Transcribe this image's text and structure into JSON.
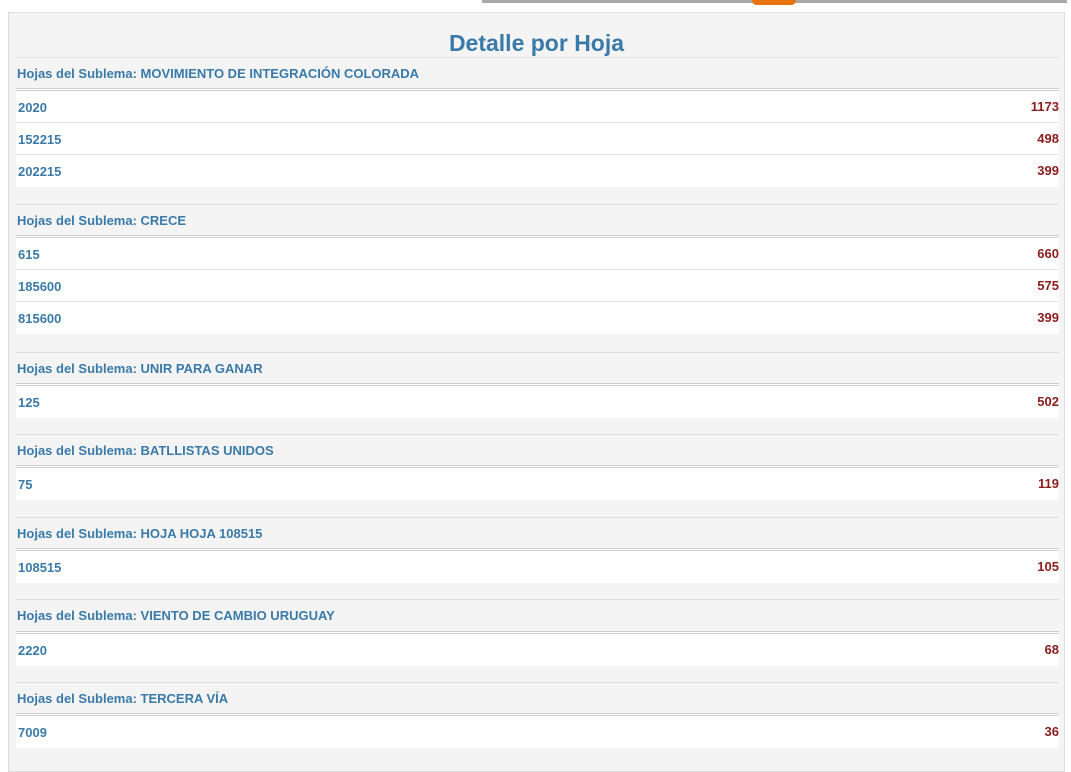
{
  "title": "Detalle por Hoja",
  "groups": [
    {
      "header": "Hojas del Sublema: MOVIMIENTO DE INTEGRACIÓN COLORADA",
      "rows": [
        {
          "key": "2020",
          "value": "1173"
        },
        {
          "key": "152215",
          "value": "498"
        },
        {
          "key": "202215",
          "value": "399"
        }
      ]
    },
    {
      "header": "Hojas del Sublema: CRECE",
      "rows": [
        {
          "key": "615",
          "value": "660"
        },
        {
          "key": "185600",
          "value": "575"
        },
        {
          "key": "815600",
          "value": "399"
        }
      ]
    },
    {
      "header": "Hojas del Sublema: UNIR PARA GANAR",
      "rows": [
        {
          "key": "125",
          "value": "502"
        }
      ]
    },
    {
      "header": "Hojas del Sublema: BATLLISTAS UNIDOS",
      "rows": [
        {
          "key": "75",
          "value": "119"
        }
      ]
    },
    {
      "header": "Hojas del Sublema: HOJA HOJA 108515",
      "rows": [
        {
          "key": "108515",
          "value": "105"
        }
      ]
    },
    {
      "header": "Hojas del Sublema: VIENTO DE CAMBIO URUGUAY",
      "rows": [
        {
          "key": "2220",
          "value": "68"
        }
      ]
    },
    {
      "header": "Hojas del Sublema: TERCERA VÍA",
      "rows": [
        {
          "key": "7009",
          "value": "36"
        }
      ]
    }
  ]
}
